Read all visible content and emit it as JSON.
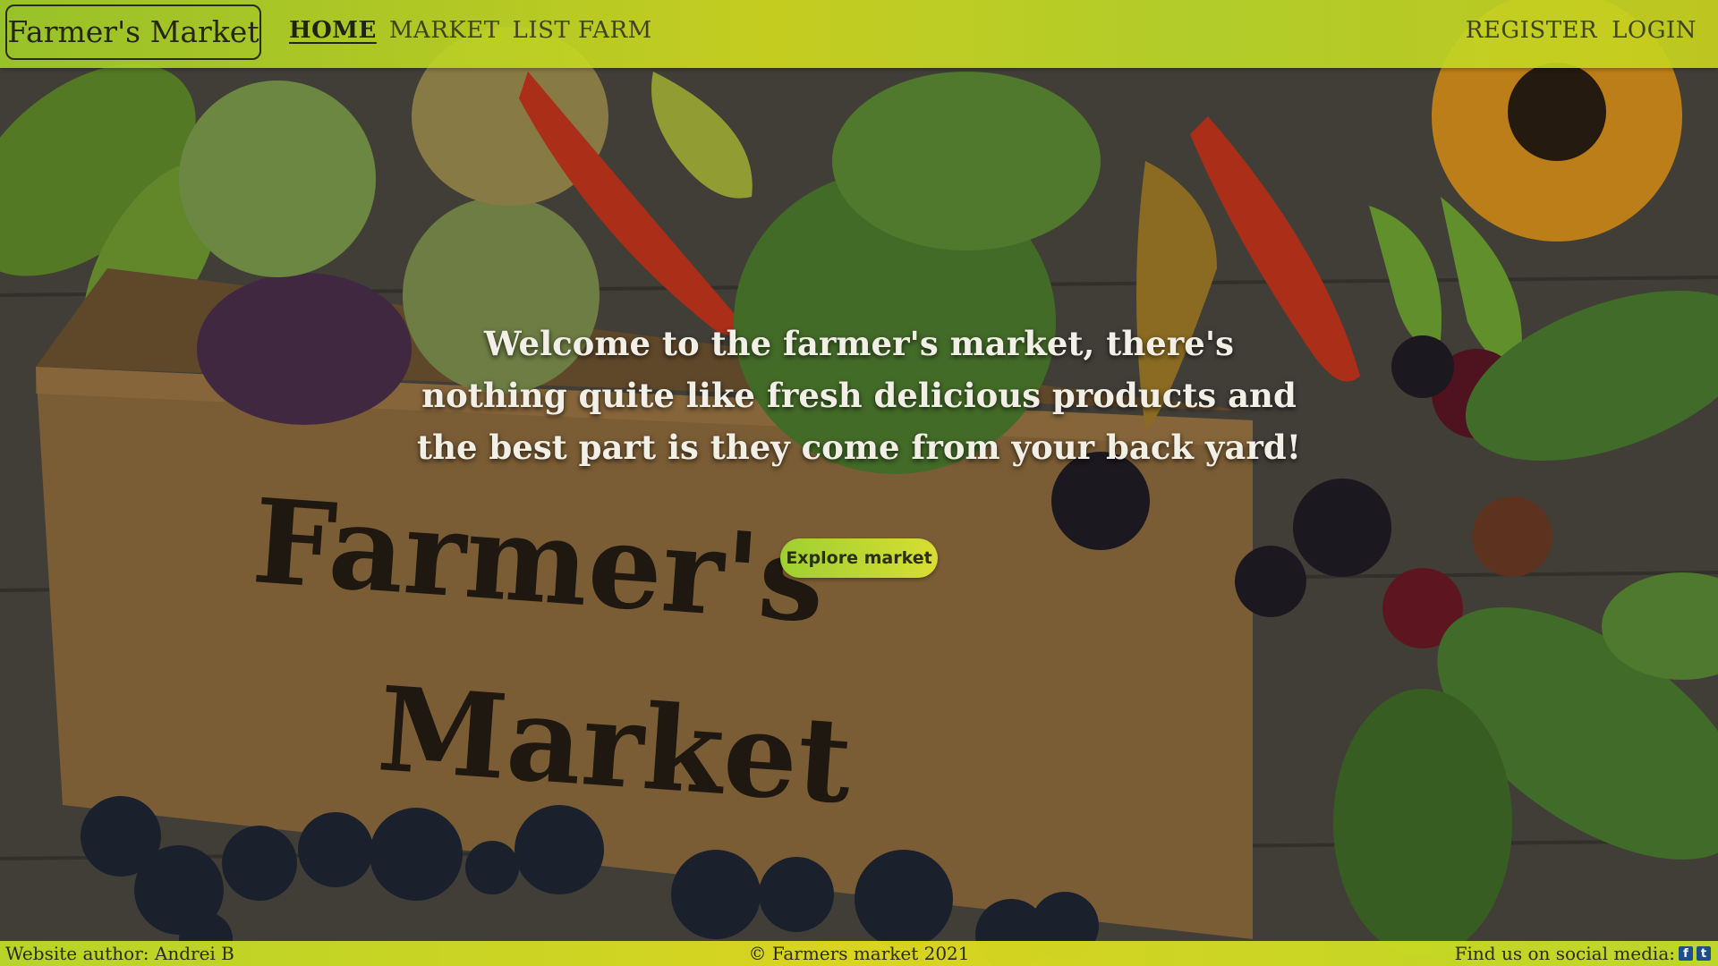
{
  "nav": {
    "brand": "Farmer's Market",
    "links": [
      {
        "label": "HOME",
        "active": true
      },
      {
        "label": "MARKET",
        "active": false
      },
      {
        "label": "LIST FARM",
        "active": false
      }
    ],
    "auth": [
      {
        "label": "REGISTER"
      },
      {
        "label": "LOGIN"
      }
    ]
  },
  "hero": {
    "crate_line1": "Farmer's",
    "crate_line2": "Market",
    "welcome_text": "Welcome to the farmer's market, there's nothing quite like fresh delicious products and the best part is they come from your back yard!",
    "button_label": "Explore market"
  },
  "footer": {
    "author": "Website author: Andrei B",
    "copyright": "© Farmers market 2021",
    "social_label": "Find us on social media:",
    "social_icons": [
      "facebook-icon",
      "twitter-icon"
    ]
  },
  "colors": {
    "nav_gradient_start": "#a0cd28",
    "nav_gradient_end": "#d2dc1e",
    "button_gradient_start": "#9fcf33",
    "button_gradient_end": "#d8de32",
    "welcome_text": "#f2efe6"
  }
}
